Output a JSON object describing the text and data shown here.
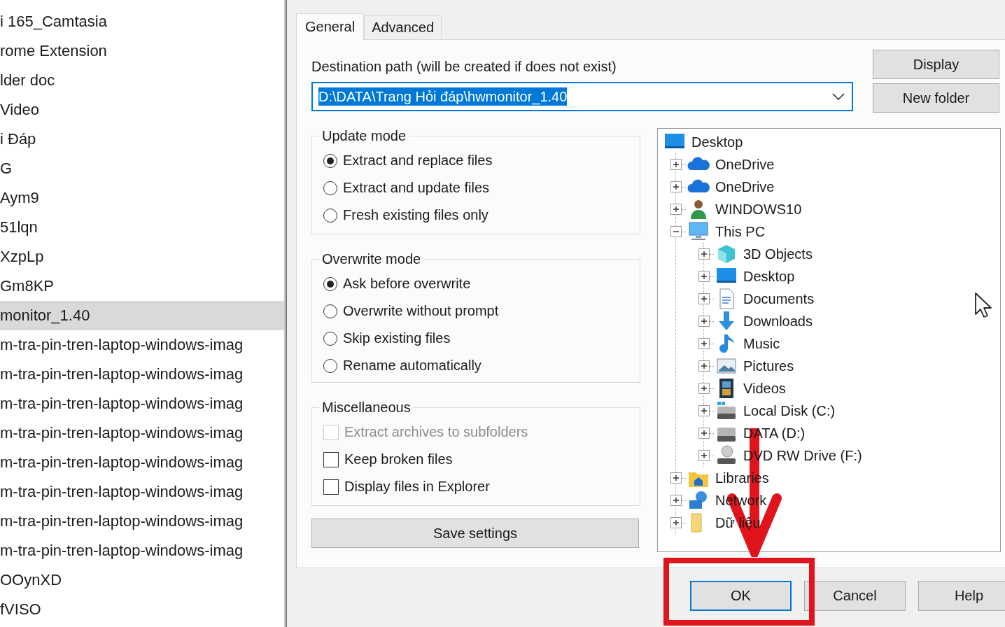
{
  "file_list": {
    "items": [
      {
        "label": "i 165_Camtasia",
        "selected": false
      },
      {
        "label": "rome Extension",
        "selected": false
      },
      {
        "label": "lder doc",
        "selected": false
      },
      {
        "label": "Video",
        "selected": false
      },
      {
        "label": "i Đáp",
        "selected": false
      },
      {
        "label": "G",
        "selected": false
      },
      {
        "label": "Aym9",
        "selected": false
      },
      {
        "label": "51lqn",
        "selected": false
      },
      {
        "label": "XzpLp",
        "selected": false
      },
      {
        "label": "Gm8KP",
        "selected": false
      },
      {
        "label": "monitor_1.40",
        "selected": true
      },
      {
        "label": "m-tra-pin-tren-laptop-windows-imag",
        "selected": false
      },
      {
        "label": "m-tra-pin-tren-laptop-windows-imag",
        "selected": false
      },
      {
        "label": "m-tra-pin-tren-laptop-windows-imag",
        "selected": false
      },
      {
        "label": "m-tra-pin-tren-laptop-windows-imag",
        "selected": false
      },
      {
        "label": "m-tra-pin-tren-laptop-windows-imag",
        "selected": false
      },
      {
        "label": "m-tra-pin-tren-laptop-windows-imag",
        "selected": false
      },
      {
        "label": "m-tra-pin-tren-laptop-windows-imag",
        "selected": false
      },
      {
        "label": "m-tra-pin-tren-laptop-windows-imag",
        "selected": false
      },
      {
        "label": "OOynXD",
        "selected": false
      },
      {
        "label": "fVISO",
        "selected": false
      }
    ]
  },
  "tabs": [
    {
      "label": "General",
      "selected": true
    },
    {
      "label": "Advanced",
      "selected": false
    }
  ],
  "destination": {
    "label": "Destination path (will be created if does not exist)",
    "value": "D:\\DATA\\Trang Hỏi đáp\\hwmonitor_1.40"
  },
  "side_buttons": [
    "Display",
    "New folder"
  ],
  "update_mode": {
    "title": "Update mode",
    "options": [
      {
        "label": "Extract and replace files",
        "selected": true
      },
      {
        "label": "Extract and update files",
        "selected": false
      },
      {
        "label": "Fresh existing files only",
        "selected": false
      }
    ]
  },
  "overwrite_mode": {
    "title": "Overwrite mode",
    "options": [
      {
        "label": "Ask before overwrite",
        "selected": true
      },
      {
        "label": "Overwrite without prompt",
        "selected": false
      },
      {
        "label": "Skip existing files",
        "selected": false
      },
      {
        "label": "Rename automatically",
        "selected": false
      }
    ]
  },
  "miscellaneous": {
    "title": "Miscellaneous",
    "options": [
      {
        "label": "Extract archives to subfolders",
        "checked": false,
        "disabled": true
      },
      {
        "label": "Keep broken files",
        "checked": false,
        "disabled": false
      },
      {
        "label": "Display files in Explorer",
        "checked": false,
        "disabled": false
      }
    ]
  },
  "save_button": "Save settings",
  "folder_tree": [
    {
      "label": "Desktop",
      "kind": "monitor",
      "children": [
        {
          "label": "OneDrive",
          "kind": "cloud",
          "expanded": false
        },
        {
          "label": "OneDrive",
          "kind": "cloud",
          "expanded": false
        },
        {
          "label": "WINDOWS10",
          "kind": "user",
          "expanded": false
        },
        {
          "label": "This PC",
          "kind": "pc",
          "expanded": true,
          "children": [
            {
              "label": "3D Objects",
              "kind": "cube",
              "expanded": false
            },
            {
              "label": "Desktop",
              "kind": "monitor",
              "expanded": false
            },
            {
              "label": "Documents",
              "kind": "document",
              "expanded": false
            },
            {
              "label": "Downloads",
              "kind": "download",
              "expanded": false
            },
            {
              "label": "Music",
              "kind": "music",
              "expanded": false
            },
            {
              "label": "Pictures",
              "kind": "picture",
              "expanded": false
            },
            {
              "label": "Videos",
              "kind": "video",
              "expanded": false
            },
            {
              "label": "Local Disk (C:)",
              "kind": "disk",
              "expanded": false
            },
            {
              "label": "DATA (D:)",
              "kind": "drive",
              "expanded": false
            },
            {
              "label": "DVD RW Drive (F:)",
              "kind": "optical",
              "expanded": false
            }
          ]
        },
        {
          "label": "Libraries",
          "kind": "library",
          "expanded": false
        },
        {
          "label": "Network",
          "kind": "network",
          "expanded": false
        },
        {
          "label": "Dữ liệu",
          "kind": "folder",
          "expanded": false
        }
      ]
    }
  ],
  "dialog_buttons": [
    {
      "label": "OK",
      "focused": true
    },
    {
      "label": "Cancel",
      "focused": false
    },
    {
      "label": "Help",
      "focused": false
    }
  ]
}
